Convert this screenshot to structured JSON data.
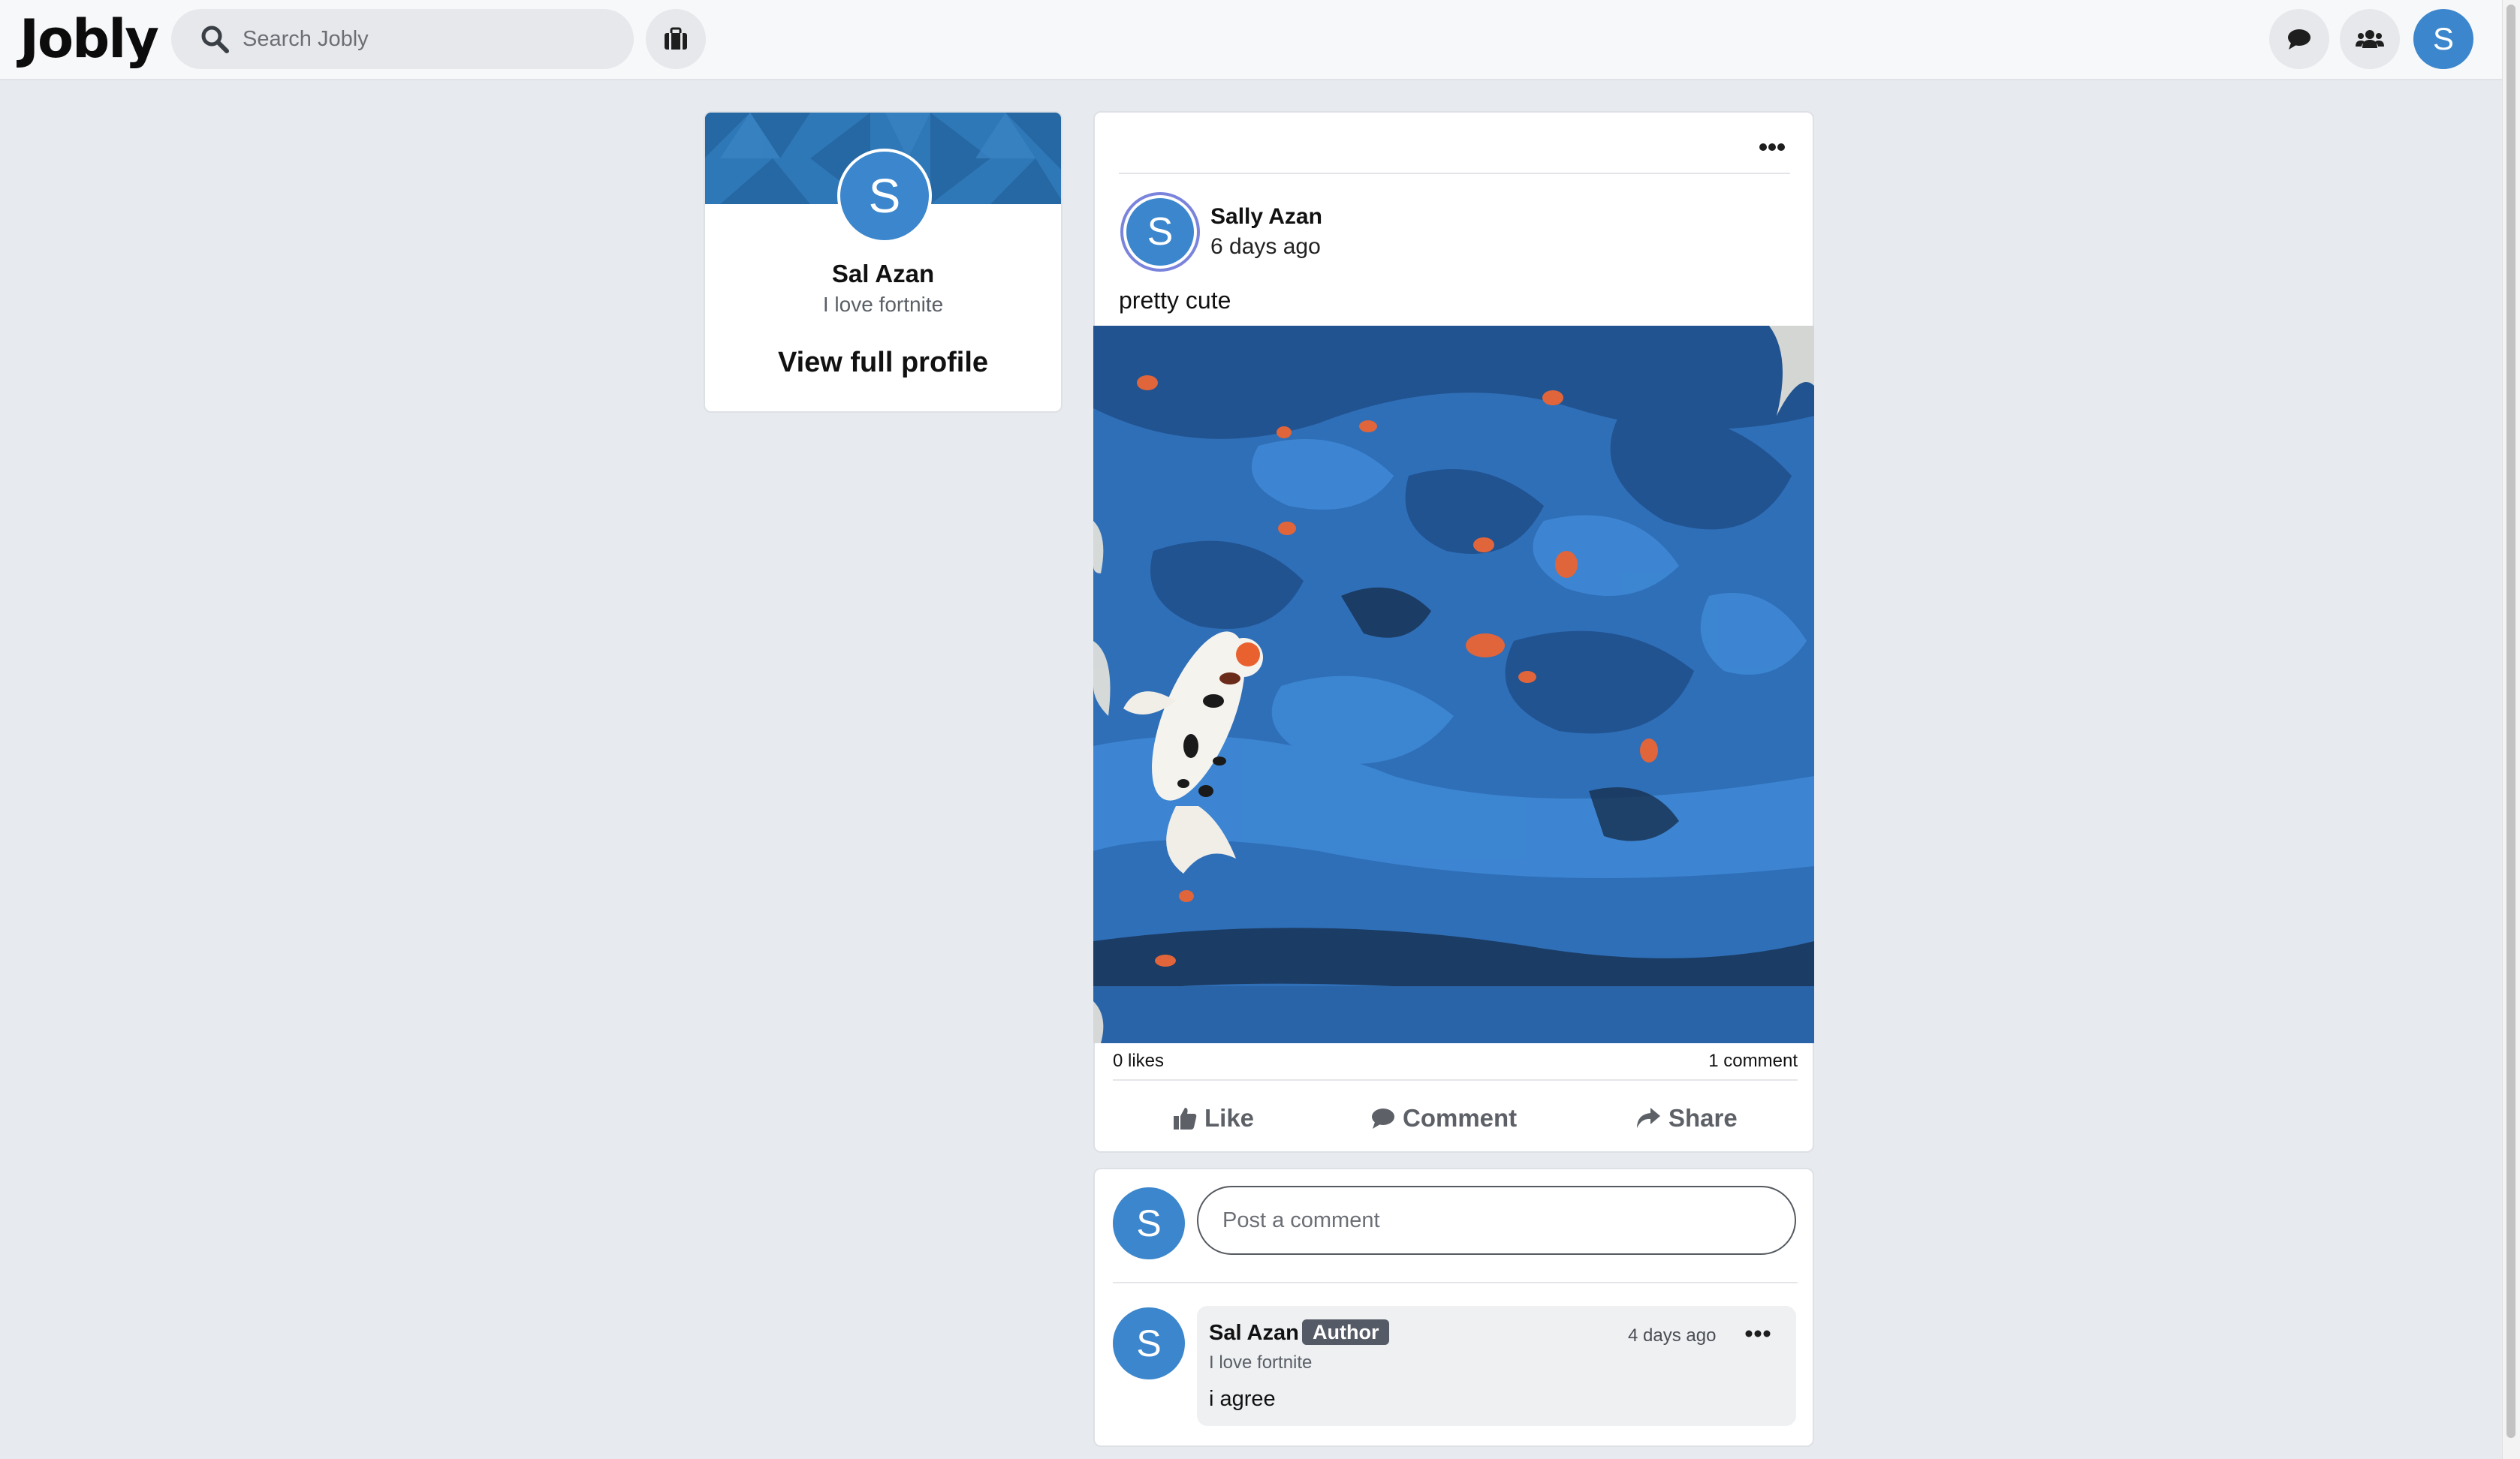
{
  "header": {
    "logo": "Jobly",
    "search_placeholder": "Search Jobly",
    "user_initial": "S"
  },
  "profile_card": {
    "initial": "S",
    "name": "Sal Azan",
    "tagline": "I love fortnite",
    "link_label": "View full profile"
  },
  "post": {
    "author_initial": "S",
    "author_name": "Sally Azan",
    "time": "6 days ago",
    "text": "pretty cute",
    "likes": "0 likes",
    "comments": "1 comment",
    "actions": {
      "like": "Like",
      "comment": "Comment",
      "share": "Share"
    }
  },
  "comments_section": {
    "my_initial": "S",
    "input_placeholder": "Post a comment",
    "items": [
      {
        "initial": "S",
        "name": "Sal Azan",
        "badge": "Author",
        "time": "4 days ago",
        "tagline": "I love fortnite",
        "text": "i agree"
      }
    ]
  },
  "colors": {
    "avatar": "#3b86cc",
    "page_bg": "#e7eaef",
    "badge": "#545a66",
    "banner": "#2f78b8"
  }
}
